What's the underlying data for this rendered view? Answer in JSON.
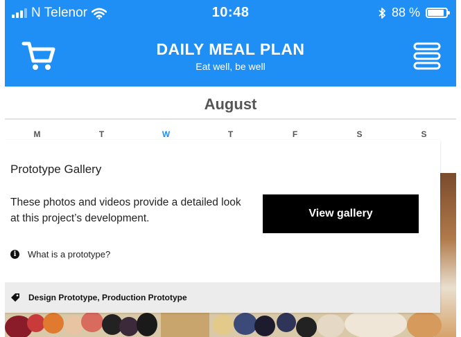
{
  "status_bar": {
    "carrier": "N Telenor",
    "time": "10:48",
    "battery_percent": "88 %",
    "battery_level": 0.88
  },
  "app_bar": {
    "title": "DAILY MEAL PLAN",
    "subtitle": "Eat well, be well"
  },
  "calendar": {
    "month": "August",
    "weekdays": [
      "M",
      "T",
      "W",
      "T",
      "F",
      "S",
      "S"
    ],
    "highlighted_index": 2
  },
  "gallery_card": {
    "title": "Prototype Gallery",
    "description": "These photos and videos provide a detailed look at this project’s development.",
    "button_label": "View gallery",
    "info_link": "What is a prototype?",
    "tags": "Design Prototype, Production Prototype"
  },
  "colors": {
    "brand_blue": "#1f8ff5",
    "button_black": "#000000",
    "tag_bar": "#ececec"
  },
  "icons": [
    "signal-icon",
    "wifi-icon",
    "bluetooth-icon",
    "battery-icon",
    "cart-icon",
    "menu-icon",
    "info-icon",
    "tag-icon"
  ]
}
